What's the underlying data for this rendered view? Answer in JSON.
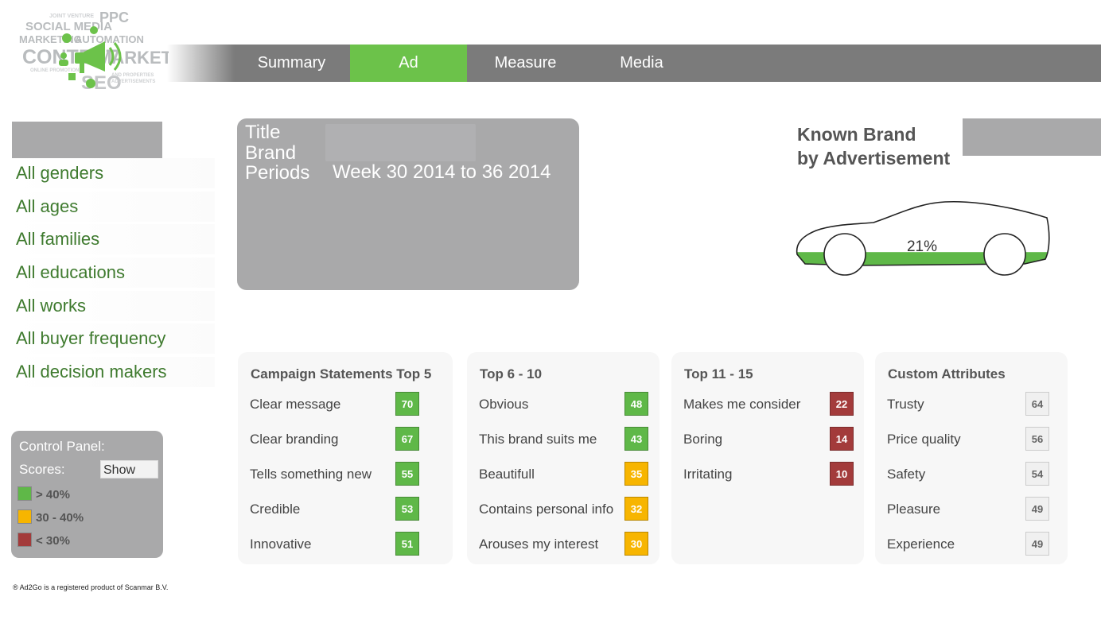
{
  "nav": {
    "tabs": [
      {
        "label": "Summary",
        "active": false
      },
      {
        "label": "Ad",
        "active": true
      },
      {
        "label": "Measure",
        "active": false
      },
      {
        "label": "Media",
        "active": false
      }
    ]
  },
  "logo": {
    "words": [
      "SOCIAL MEDIA",
      "PPC",
      "MARKETING",
      "AUTOMATION",
      "CONTENT",
      "MARKETING",
      "SEO"
    ]
  },
  "filters": [
    "All genders",
    "All ages",
    "All families",
    "All educations",
    "All works",
    "All buyer frequency",
    "All decision makers"
  ],
  "control_panel": {
    "title": "Control Panel:",
    "scores_label": "Scores:",
    "scores_value": "Show",
    "legend": [
      {
        "label": "> 40%",
        "color": "#5fb848"
      },
      {
        "label": "30 - 40%",
        "color": "#f7b500"
      },
      {
        "label": "< 30%",
        "color": "#a33b3b"
      }
    ]
  },
  "copyright": "® Ad2Go is a registered product of Scanmar B.V.",
  "info": {
    "title_label": "Title",
    "brand_label": "Brand",
    "periods_label": "Periods",
    "periods_value": "Week 30 2014 to 36 2014"
  },
  "known_brand": {
    "title_line1": "Known Brand",
    "title_line2": "by Advertisement",
    "value": "21%",
    "fill_fraction": 0.21,
    "fill_color": "#5fb848"
  },
  "cards": [
    {
      "title": "Campaign Statements Top 5",
      "items": [
        {
          "label": "Clear message",
          "score": "70",
          "level": "green"
        },
        {
          "label": "Clear branding",
          "score": "67",
          "level": "green"
        },
        {
          "label": "Tells something new",
          "score": "55",
          "level": "green"
        },
        {
          "label": "Credible",
          "score": "53",
          "level": "green"
        },
        {
          "label": "Innovative",
          "score": "51",
          "level": "green"
        }
      ]
    },
    {
      "title": "Top 6 - 10",
      "items": [
        {
          "label": "Obvious",
          "score": "48",
          "level": "green"
        },
        {
          "label": "This brand suits me",
          "score": "43",
          "level": "green"
        },
        {
          "label": "Beautifull",
          "score": "35",
          "level": "amber"
        },
        {
          "label": "Contains personal info",
          "score": "32",
          "level": "amber"
        },
        {
          "label": "Arouses my interest",
          "score": "30",
          "level": "amber"
        }
      ]
    },
    {
      "title": "Top 11 - 15",
      "items": [
        {
          "label": "Makes me consider",
          "score": "22",
          "level": "red"
        },
        {
          "label": "Boring",
          "score": "14",
          "level": "red"
        },
        {
          "label": "Irritating",
          "score": "10",
          "level": "red"
        }
      ]
    },
    {
      "title": "Custom Attributes",
      "items": [
        {
          "label": "Trusty",
          "score": "64",
          "level": "neutral"
        },
        {
          "label": "Price quality",
          "score": "56",
          "level": "neutral"
        },
        {
          "label": "Safety",
          "score": "54",
          "level": "neutral"
        },
        {
          "label": "Pleasure",
          "score": "49",
          "level": "neutral"
        },
        {
          "label": "Experience",
          "score": "49",
          "level": "neutral"
        }
      ]
    }
  ]
}
